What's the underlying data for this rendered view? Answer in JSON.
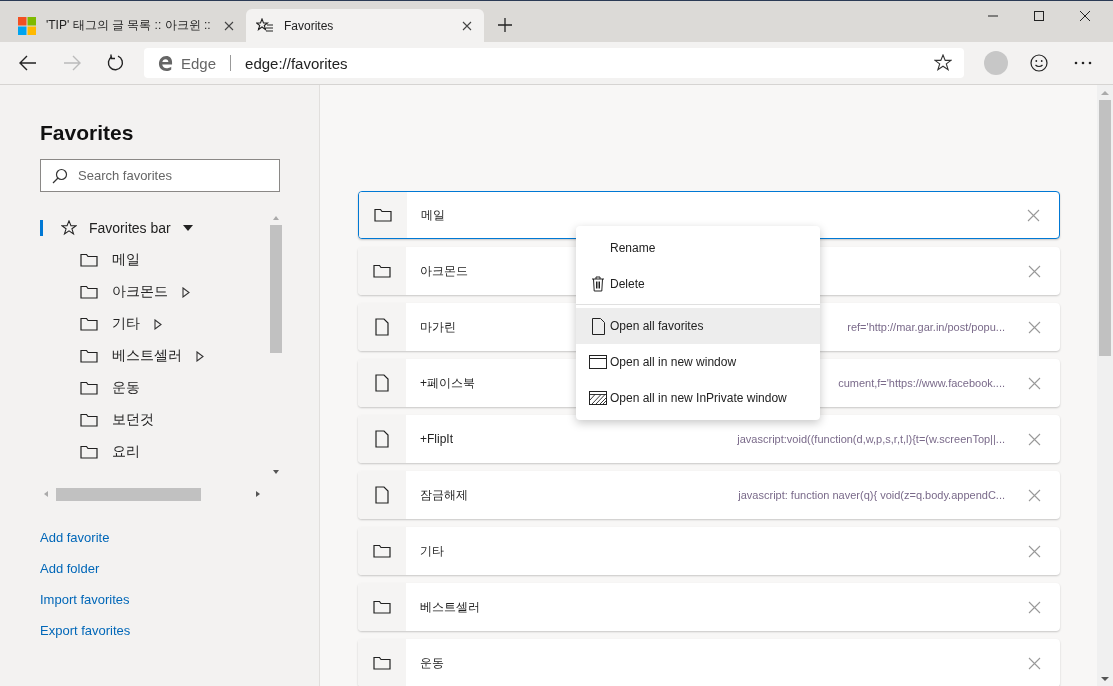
{
  "tabs": [
    {
      "title": "'TIP' 태그의 글 목록 :: 아크윈 ::",
      "kind": "site",
      "selected": false
    },
    {
      "title": "Favorites",
      "kind": "favorites",
      "selected": true
    }
  ],
  "address_bar": {
    "site_label": "Edge",
    "url": "edge://favorites"
  },
  "sidebar": {
    "title": "Favorites",
    "search": {
      "placeholder": "Search favorites"
    },
    "tree": [
      {
        "label": "Favorites bar",
        "kind": "star",
        "selected": true,
        "expanded": true,
        "children": [
          {
            "label": "메일",
            "kind": "folder",
            "expandable": false
          },
          {
            "label": "아크몬드",
            "kind": "folder",
            "expandable": true
          },
          {
            "label": "기타",
            "kind": "folder",
            "expandable": true
          },
          {
            "label": "베스트셀러",
            "kind": "folder",
            "expandable": true
          },
          {
            "label": "운동",
            "kind": "folder",
            "expandable": false
          },
          {
            "label": "보던것",
            "kind": "folder",
            "expandable": false
          },
          {
            "label": "요리",
            "kind": "folder",
            "expandable": false
          }
        ]
      }
    ],
    "links": [
      "Add favorite",
      "Add folder",
      "Import favorites",
      "Export favorites"
    ]
  },
  "favorites": [
    {
      "name": "메일",
      "kind": "folder",
      "selected": true
    },
    {
      "name": "아크몬드",
      "kind": "folder",
      "selected": false
    },
    {
      "name": "마가린",
      "kind": "page",
      "url": "ref='http://mar.gar.in/post/popu...",
      "selected": false
    },
    {
      "name": "+페이스북",
      "kind": "page",
      "url": "cument,f='https://www.facebook....",
      "selected": false
    },
    {
      "name": "+FlipIt",
      "kind": "page",
      "url": "javascript:void((function(d,w,p,s,r,t,l){t=(w.screenTop||...",
      "selected": false
    },
    {
      "name": "잠금해제",
      "kind": "page",
      "url": "javascript: function naver(q){ void(z=q.body.appendC...",
      "selected": false
    },
    {
      "name": "기타",
      "kind": "folder",
      "selected": false
    },
    {
      "name": "베스트셀러",
      "kind": "folder",
      "selected": false
    },
    {
      "name": "운동",
      "kind": "folder",
      "selected": false
    }
  ],
  "context_menu": {
    "groups": [
      [
        {
          "label": "Rename",
          "kind": "none",
          "selected": false
        },
        {
          "label": "Delete",
          "kind": "trash",
          "selected": false
        }
      ],
      [
        {
          "label": "Open all favorites",
          "kind": "page",
          "selected": true
        },
        {
          "label": "Open all in new window",
          "kind": "window",
          "selected": false
        },
        {
          "label": "Open all in new InPrivate window",
          "kind": "private",
          "selected": false
        }
      ]
    ]
  }
}
